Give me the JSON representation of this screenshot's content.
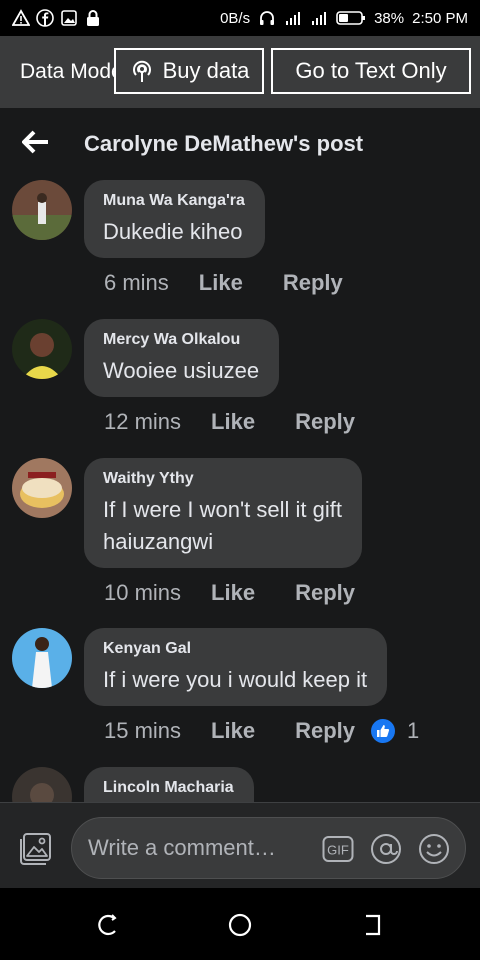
{
  "status_bar": {
    "speed": "0B/s",
    "battery": "38%",
    "time": "2:50 PM"
  },
  "data_bar": {
    "data_mode_label": "Data Mode",
    "buy_data_label": "Buy data",
    "text_only_label": "Go to Text Only"
  },
  "header": {
    "title": "Carolyne DeMathew's post"
  },
  "comments": [
    {
      "author": "Muna Wa Kanga'ra",
      "text": "Dukedie kiheo",
      "time": "6 mins",
      "like": "Like",
      "reply": "Reply"
    },
    {
      "author": "Mercy Wa Olkalou",
      "text": "Wooiee usiuzee",
      "time": "12 mins",
      "like": "Like",
      "reply": "Reply"
    },
    {
      "author": "Waithy Ythy",
      "text_line1": "If I were I won't sell it gift",
      "text_line2": "haiuzangwi",
      "time": "10 mins",
      "like": "Like",
      "reply": "Reply"
    },
    {
      "author": "Kenyan Gal",
      "text": "If i were you i would keep it",
      "time": "15 mins",
      "like": "Like",
      "reply": "Reply",
      "reaction_count": "1"
    },
    {
      "author": "Lincoln Macharia"
    }
  ],
  "composer": {
    "placeholder": "Write a comment…",
    "gif_label": "GIF"
  },
  "colors": {
    "background": "#18191a",
    "bubble": "#3a3b3c",
    "accent": "#1877f2"
  }
}
